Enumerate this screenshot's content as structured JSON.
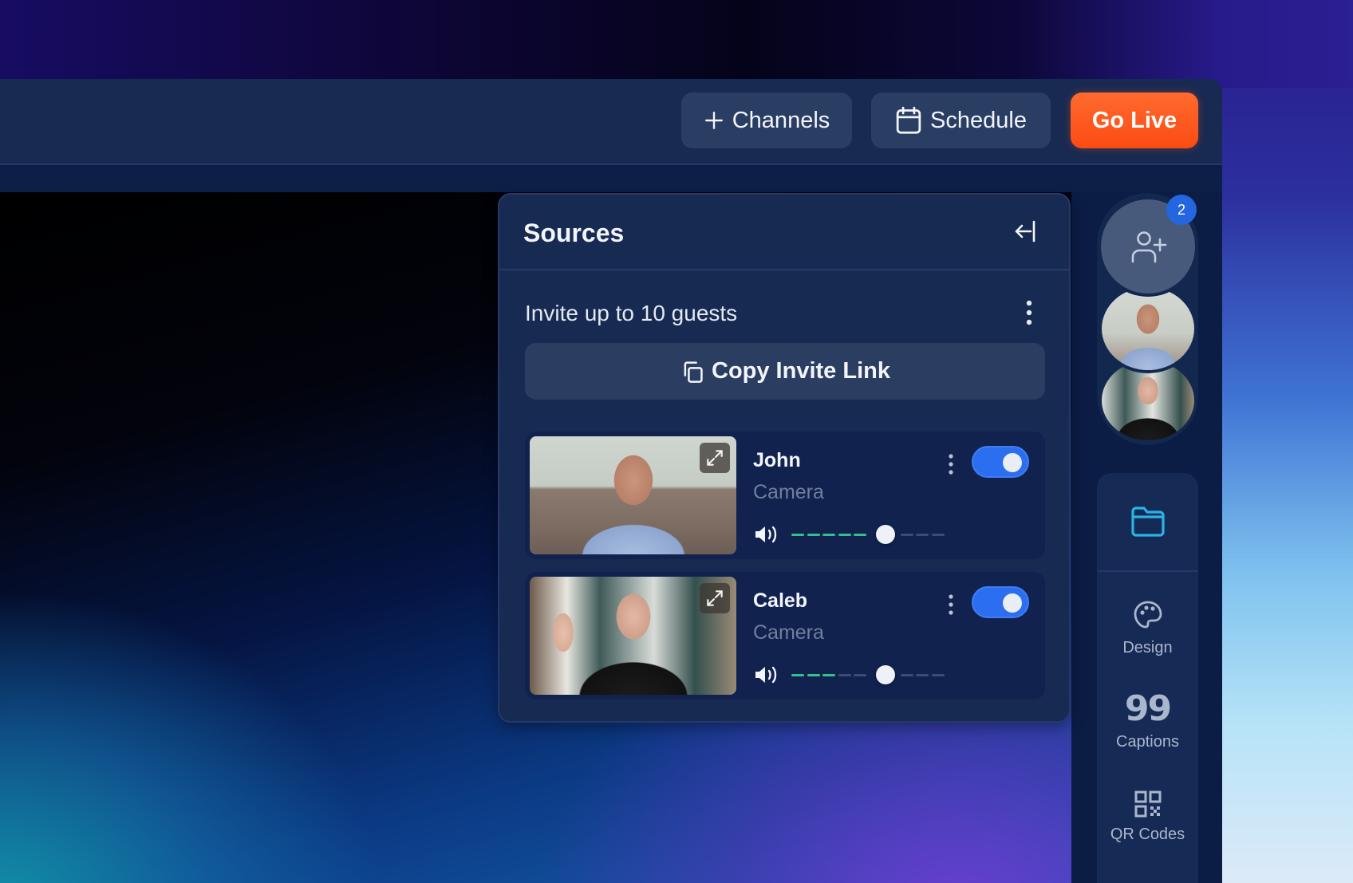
{
  "topbar": {
    "channels_label": "Channels",
    "channels_icon": "plus-icon",
    "schedule_label": "Schedule",
    "schedule_icon": "calendar-icon",
    "go_live_label": "Go Live"
  },
  "sources_panel": {
    "title": "Sources",
    "collapse_icon": "collapse-left-icon",
    "invite_text": "Invite up to 10 guests",
    "copy_invite_label": "Copy Invite Link",
    "sources": [
      {
        "name": "John",
        "type": "Camera",
        "enabled": true,
        "volume_level": 0.6,
        "meter_active_segments": 5
      },
      {
        "name": "Caleb",
        "type": "Camera",
        "enabled": true,
        "volume_level": 0.6,
        "meter_active_segments": 3
      }
    ]
  },
  "right_rail": {
    "guest_count_badge": "2",
    "add_guest_icon": "user-plus-icon",
    "tools": [
      {
        "id": "folder",
        "label": "",
        "icon": "folder-icon",
        "active": true
      },
      {
        "id": "design",
        "label": "Design",
        "icon": "palette-icon"
      },
      {
        "id": "captions",
        "label": "Captions",
        "icon": "quote-icon"
      },
      {
        "id": "qr",
        "label": "QR Codes",
        "icon": "qr-code-icon"
      }
    ]
  },
  "colors": {
    "go_live": "#fc4b12",
    "toggle_on": "#2b6ff0",
    "meter_active": "#35c08f",
    "accent_folder": "#2bb3e6",
    "badge": "#2366e0"
  }
}
